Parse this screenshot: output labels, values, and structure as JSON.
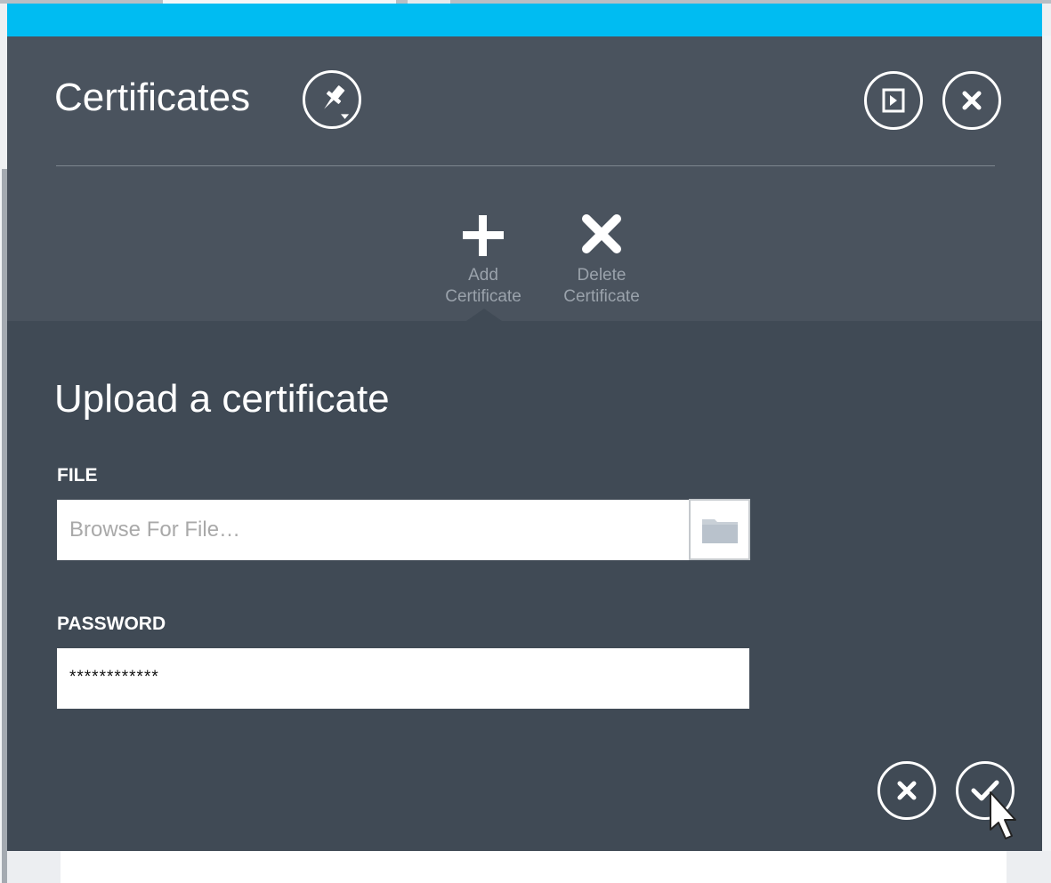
{
  "blade": {
    "title": "Certificates",
    "pin_icon": "pin-icon",
    "expand_icon": "expand-icon",
    "close_icon": "close-icon"
  },
  "commands": [
    {
      "label": "Add\nCertificate",
      "icon": "plus-icon"
    },
    {
      "label": "Delete\nCertificate",
      "icon": "x-icon"
    }
  ],
  "form": {
    "heading": "Upload a certificate",
    "file_label": "FILE",
    "file_placeholder": "Browse For File…",
    "password_label": "PASSWORD",
    "password_value": "************"
  },
  "footer": {
    "cancel_icon": "close-icon",
    "confirm_icon": "checkmark-icon"
  },
  "colors": {
    "accent": "#00bcf2",
    "blade_header": "#4a535e",
    "blade_body": "#404a55",
    "command_label": "#9aa2ab",
    "folder_icon": "#b9c2cc"
  }
}
